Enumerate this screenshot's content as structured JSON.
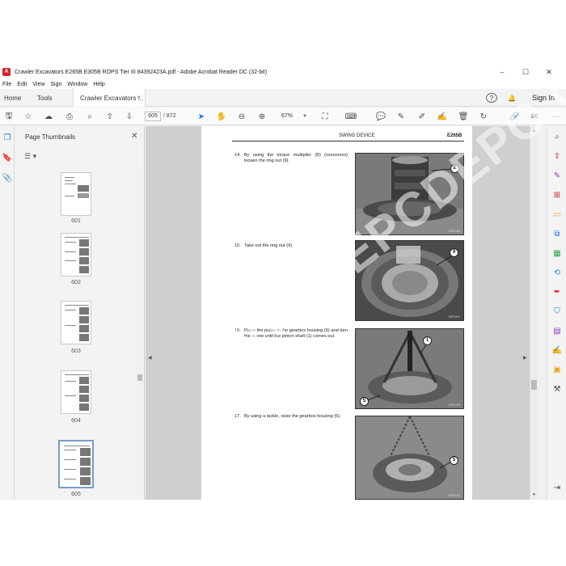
{
  "window": {
    "title": "Crawler Excavators E265B E305B ROPS Tier III 84392423A.pdf - Adobe Acrobat Reader DC (32-bit)",
    "minimize": "–",
    "maximize": "☐",
    "close": "✕"
  },
  "menu": [
    "File",
    "Edit",
    "View",
    "Sign",
    "Window",
    "Help"
  ],
  "tabs": {
    "home": "Home",
    "tools": "Tools",
    "document": "Crawler Excavators ...",
    "close": "×"
  },
  "account": {
    "help": "?",
    "notifications": "🔔",
    "sign_in": "Sign In"
  },
  "toolbar": {
    "current_page": "605",
    "total_pages": "/ 872",
    "zoom": "67%"
  },
  "thumbnails_panel": {
    "title": "Page Thumbnails",
    "close": "✕",
    "options": "☰ ▾",
    "pages": [
      {
        "label": "601",
        "selected": false
      },
      {
        "label": "602",
        "selected": false
      },
      {
        "label": "603",
        "selected": false
      },
      {
        "label": "604",
        "selected": false
      },
      {
        "label": "605",
        "selected": true
      }
    ]
  },
  "page": {
    "header_section": "SWING DEVICE",
    "header_model": "E265B",
    "steps": [
      {
        "number": "14.",
        "text": "By using the torque multiplier (B) (xxxxxxxxx) loosen the ring nut (9).",
        "callouts": [
          "B"
        ],
        "code": "S9F1V05"
      },
      {
        "number": "15.",
        "text": "Take out the ring nut (9).",
        "callouts": [
          "9"
        ],
        "code": "S9F1V07"
      },
      {
        "number": "16.",
        "text": "Place the puller in the gearbox housing (5) and turn the screw until the pinion shaft (1) comes out.",
        "callouts": [
          "1",
          "5"
        ],
        "code": "S9F1V09"
      },
      {
        "number": "17.",
        "text": "By using a tackle, raise the gearbox housing (5).",
        "callouts": [
          "5"
        ],
        "code": "S9F1V10"
      }
    ]
  },
  "watermark": "WWW.EPCDEPO.COM",
  "colors": {
    "accent": "#1473e6",
    "adobe_red": "#d6201f",
    "page_bg": "#ffffff",
    "doc_bg": "#cfcfcf"
  }
}
